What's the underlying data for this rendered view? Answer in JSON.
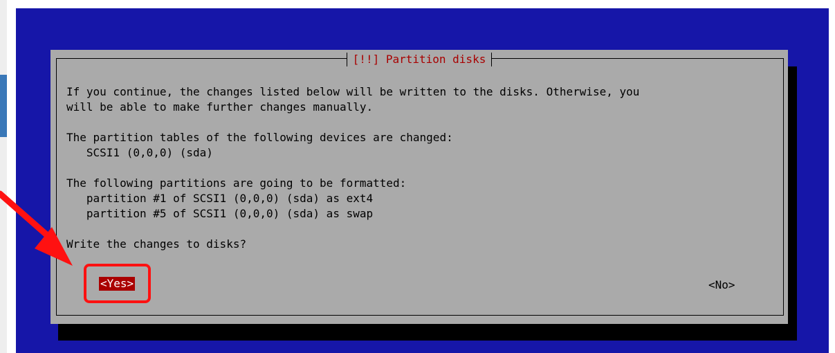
{
  "dialog": {
    "title": "[!!] Partition disks",
    "lines": [
      "If you continue, the changes listed below will be written to the disks. Otherwise, you",
      "will be able to make further changes manually.",
      "",
      "The partition tables of the following devices are changed:",
      "   SCSI1 (0,0,0) (sda)",
      "",
      "The following partitions are going to be formatted:",
      "   partition #1 of SCSI1 (0,0,0) (sda) as ext4",
      "   partition #5 of SCSI1 (0,0,0) (sda) as swap",
      "",
      "Write the changes to disks?"
    ]
  },
  "buttons": {
    "yes": "<Yes>",
    "no": "<No>"
  },
  "colors": {
    "background_blue": "#1616a8",
    "dialog_gray": "#aaaaaa",
    "title_red": "#a80000",
    "selected_button": "#aa0000",
    "annotation_red": "#ff1111"
  },
  "annotation": {
    "icon": "red-arrow-icon"
  }
}
